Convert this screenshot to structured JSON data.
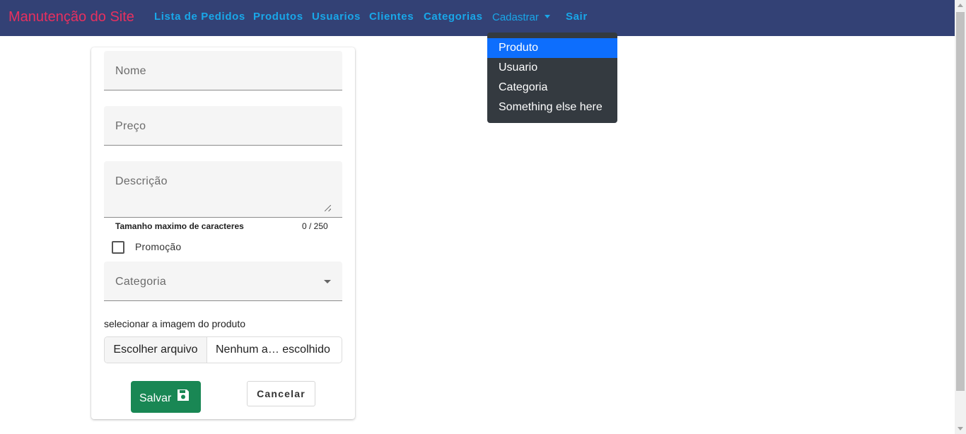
{
  "navbar": {
    "brand": "Manutenção do Site",
    "links": [
      "Lista de Pedidos",
      "Produtos",
      "Usuarios",
      "Clientes",
      "Categorias"
    ],
    "dropdown_label": "Cadastrar",
    "logout": "Sair"
  },
  "dropdown": {
    "items": [
      "Produto",
      "Usuario",
      "Categoria",
      "Something else here"
    ],
    "active_item": "Produto"
  },
  "form": {
    "name_label": "Nome",
    "price_label": "Preço",
    "description_label": "Descrição",
    "max_chars_hint": "Tamanho maximo de caracteres",
    "char_counter": "0 / 250",
    "promo_label": "Promoção",
    "promo_checked": false,
    "category_label": "Categoria",
    "image_caption": "selecionar a imagem do produto",
    "file_button": "Escolher arquivo",
    "file_status": "Nenhum a… escolhido",
    "save_label": "Salvar",
    "cancel_label": "Cancelar"
  },
  "icons": {
    "save": "floppy-disk-icon",
    "caret": "caret-down-icon"
  },
  "colors": {
    "navbar_bg": "#334175",
    "brand": "#e8305f",
    "nav_link": "#19a7e9",
    "dropdown_bg": "#343a40",
    "dropdown_active": "#0d6efd",
    "save_button": "#198754"
  }
}
